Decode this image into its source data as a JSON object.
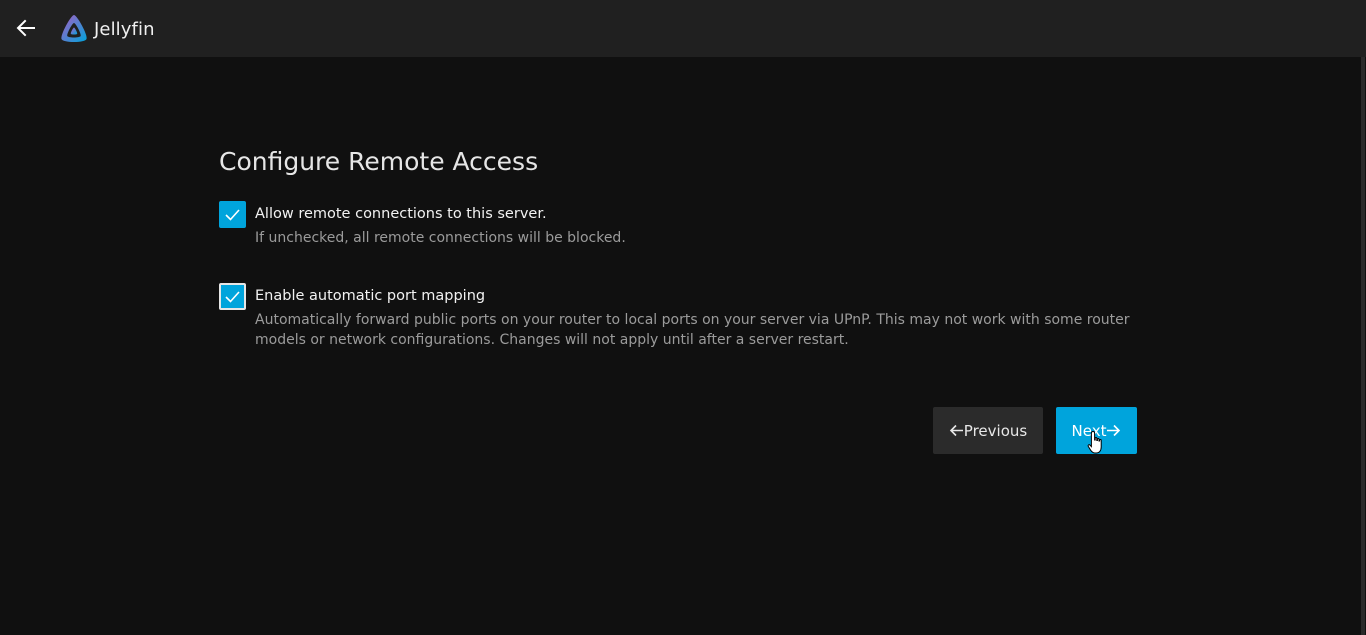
{
  "app": {
    "name": "Jellyfin"
  },
  "header": {
    "back_icon": "arrow-left-icon",
    "logo_icon": "jellyfin-logo-icon",
    "logo_text": "Jellyfin"
  },
  "page": {
    "title": "Configure Remote Access"
  },
  "options": [
    {
      "label": "Allow remote connections to this server.",
      "description": "If unchecked, all remote connections will be blocked.",
      "checked": true
    },
    {
      "label": "Enable automatic port mapping",
      "description": "Automatically forward public ports on your router to local ports on your server via UPnP. This may not work with some router models or network configurations. Changes will not apply until after a server restart.",
      "checked": true
    }
  ],
  "buttons": {
    "previous_label": "Previous",
    "next_label": "Next"
  },
  "colors": {
    "accent": "#00a4dc",
    "background": "#101010",
    "header": "#202020",
    "secondary_button": "#2b2b2b"
  }
}
